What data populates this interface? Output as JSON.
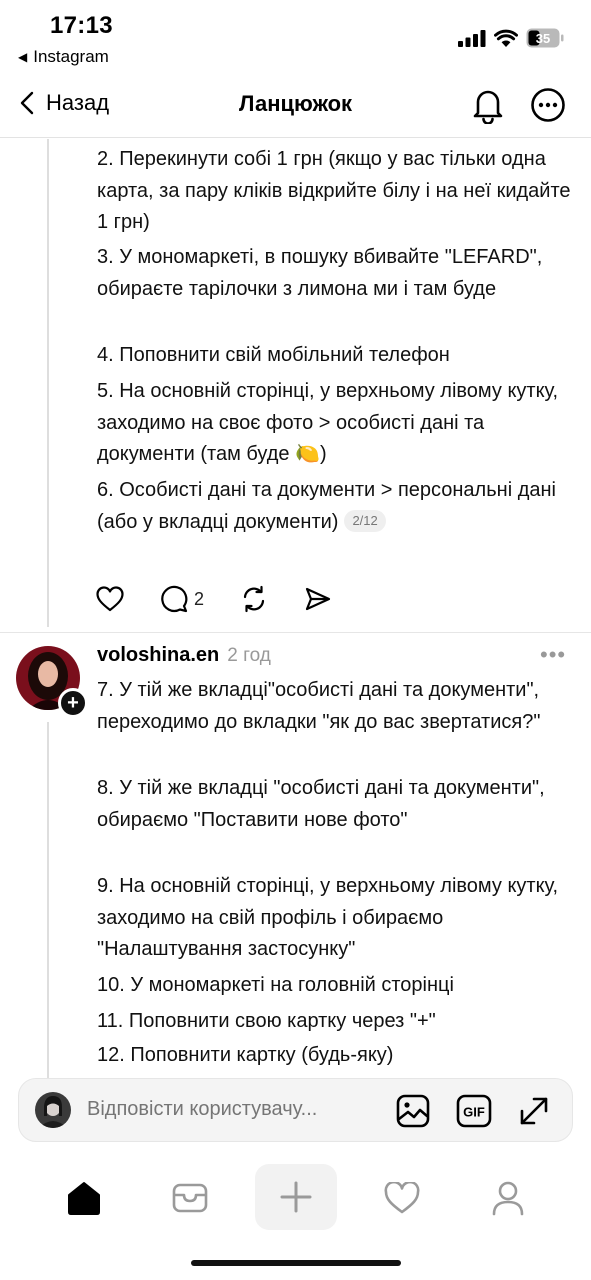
{
  "status_bar": {
    "time": "17:13",
    "back_app": "Instagram",
    "battery": "35"
  },
  "header": {
    "back_label": "Назад",
    "title": "Ланцюжок"
  },
  "post1": {
    "lines": [
      "2. Перекинути собі 1 грн (якщо у вас тільки одна карта, за пару кліків відкрийте білу і на неї кидайте 1 грн)",
      "3. У мономаркеті, в пошуку вбивайте \"LEFARD\", обираєте тарілочки з лимона ми і там буде",
      "4. Поповнити свій мобільний телефон",
      "5. На основній сторінці, у верхньому лівому кутку, заходимо на своє фото > особисті дані та документи (там буде 🍋)",
      "6. Особисті дані та документи > персональні дані (або у вкладці документи)"
    ],
    "counter": "2/12",
    "comments_count": "2"
  },
  "post2": {
    "username": "voloshina.en",
    "time": "2 год",
    "more": "•••",
    "lines": [
      "7. У тій же вкладці\"особисті дані та документи\", переходимо до вкладки \"як до вас звертатися?\"",
      "8. У тій же вкладці \"особисті дані та документи\", обираємо \"Поставити нове фото\"",
      "9. На основній сторінці, у верхньому лівому кутку, заходимо на свій профіль і обираємо \"Налаштування застосунку\"",
      "10. У мономаркеті на головній сторінці",
      "11. Поповнити свою картку через \"+\"",
      "12. Поповнити картку (будь-яку)"
    ]
  },
  "reply": {
    "placeholder": "Відповісти користувачу..."
  },
  "icons": {
    "gif_label": "GIF"
  }
}
